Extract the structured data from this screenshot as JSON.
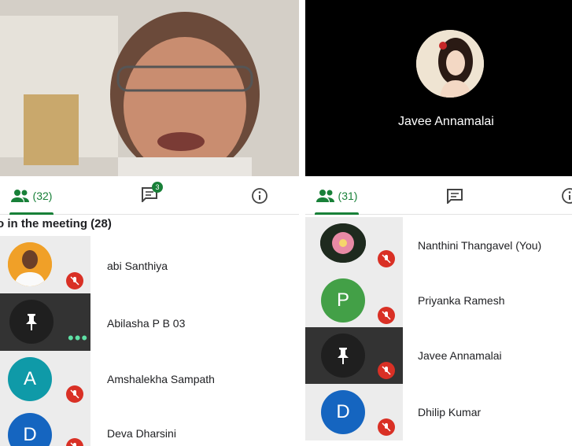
{
  "left": {
    "tabs": {
      "people_count": "(32)",
      "chat_badge": "3"
    },
    "section_title": "o in the meeting (28)",
    "participants": [
      {
        "name": "abi Santhiya",
        "avatar": "photo-man"
      },
      {
        "name": "Abilasha P B 03",
        "avatar": "pin-icon"
      },
      {
        "name": "Amshalekha Sampath",
        "avatar_letter": "A",
        "avatar_color": "#0f9aa8"
      },
      {
        "name": "Deva Dharsini",
        "avatar_letter": "D",
        "avatar_color": "#1565c0"
      }
    ]
  },
  "right": {
    "video_name": "Javee Annamalai",
    "tabs": {
      "people_count": "(31)"
    },
    "participants": [
      {
        "name": "Nanthini Thangavel (You)",
        "avatar": "photo-flower"
      },
      {
        "name": "Priyanka Ramesh",
        "avatar_letter": "P",
        "avatar_color": "#43a047"
      },
      {
        "name": "Javee Annamalai",
        "avatar": "pin-icon"
      },
      {
        "name": "Dhilip Kumar",
        "avatar_letter": "D",
        "avatar_color": "#1565c0"
      }
    ]
  },
  "colors": {
    "accent": "#188038",
    "muted_mic": "#d93025"
  }
}
